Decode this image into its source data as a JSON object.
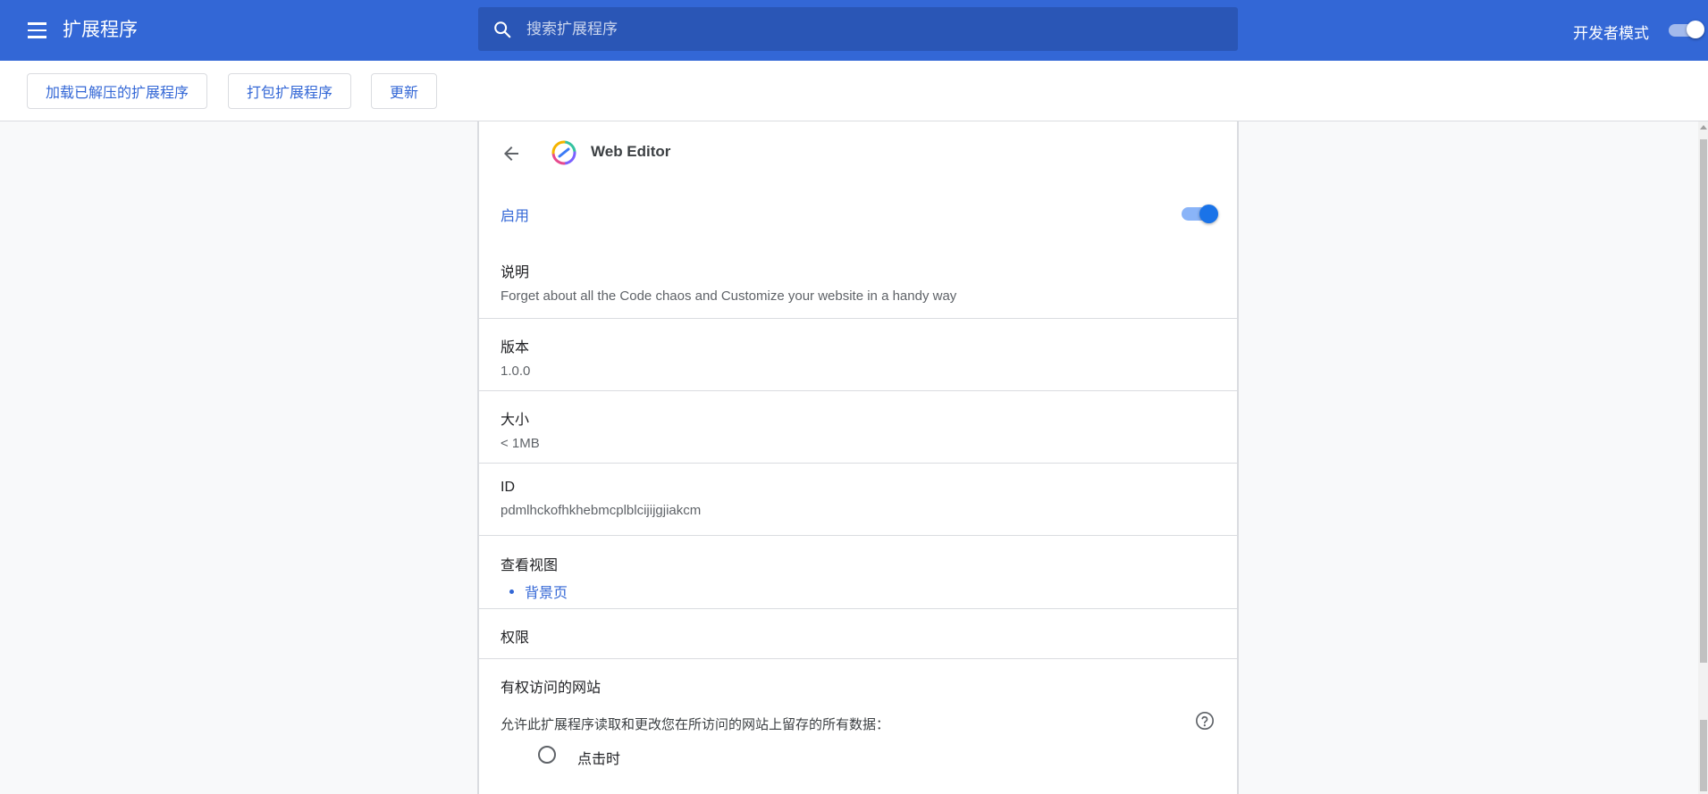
{
  "topbar": {
    "title": "扩展程序",
    "search_placeholder": "搜索扩展程序",
    "dev_mode_label": "开发者模式",
    "dev_mode_on": true
  },
  "toolbar": {
    "load_unpacked": "加载已解压的扩展程序",
    "pack": "打包扩展程序",
    "update": "更新"
  },
  "extension": {
    "name": "Web Editor",
    "enabled_label": "启用",
    "enabled": true,
    "description_title": "说明",
    "description": "Forget about all the Code chaos and Customize your website in a handy way",
    "version_title": "版本",
    "version": "1.0.0",
    "size_title": "大小",
    "size": "< 1MB",
    "id_title": "ID",
    "id": "pdmlhckofhkhebmcplblcijijgjiakcm",
    "views_title": "查看视图",
    "views": [
      "背景页"
    ],
    "permissions_title": "权限",
    "site_access_title": "有权访问的网站",
    "site_access_desc": "允许此扩展程序读取和更改您在所访问的网站上留存的所有数据：",
    "site_access_option": "点击时"
  },
  "colors": {
    "topbar": "#3367d6",
    "search": "#2a56b6",
    "accent": "#3367d6",
    "toggle_on": "#1a73e8"
  }
}
